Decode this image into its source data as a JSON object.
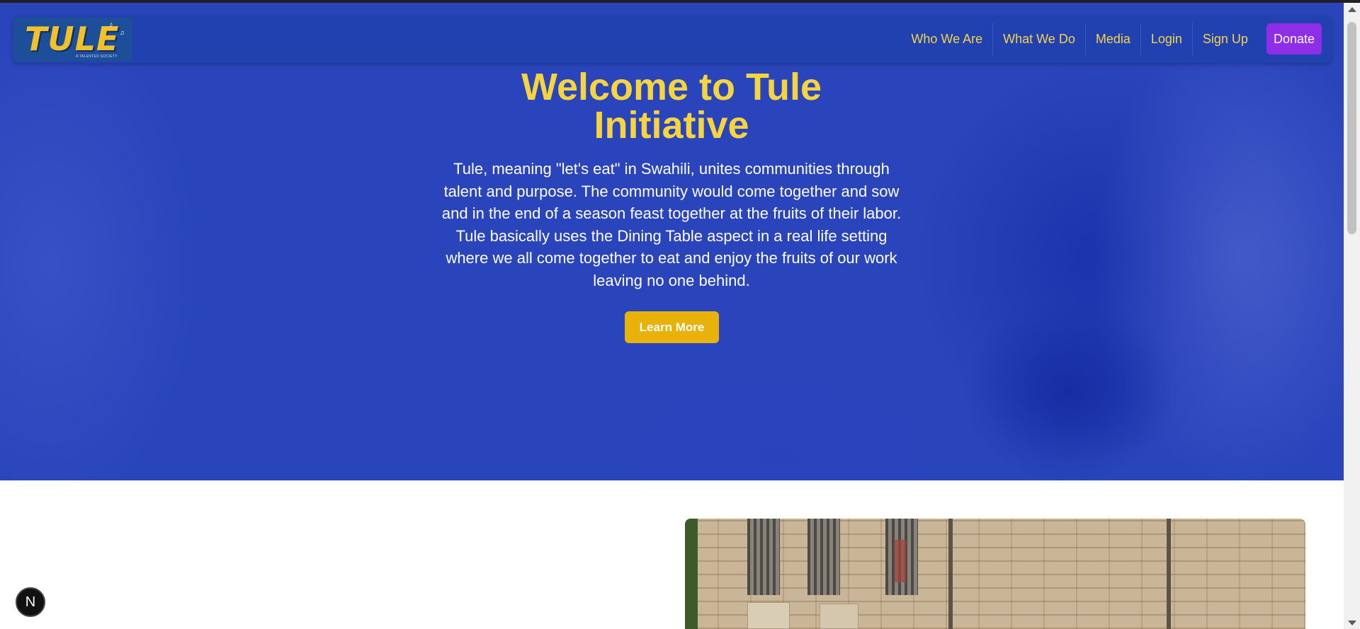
{
  "logo": {
    "text": "TULE",
    "subtext": "A TALENTED SOCIETY"
  },
  "nav": {
    "links": [
      {
        "label": "Who We Are"
      },
      {
        "label": "What We Do"
      },
      {
        "label": "Media"
      },
      {
        "label": "Login"
      },
      {
        "label": "Sign Up"
      }
    ],
    "donate_label": "Donate"
  },
  "hero": {
    "title": "Welcome to Tule Initiative",
    "text": "Tule, meaning \"let's eat\" in Swahili, unites communities through talent and purpose. The community would come together and sow and in the end of a season feast together at the fruits of their labor. Tule basically uses the Dining Table aspect in a real life setting where we all come together to eat and enjoy the fruits of our work leaving no one behind.",
    "cta_label": "Learn More"
  },
  "badge": {
    "letter": "N"
  },
  "colors": {
    "hero_bg": "#2a45bb",
    "navbar_bg": "#2141b0",
    "nav_text": "#f5d34a",
    "title": "#f6d43f",
    "donate_bg": "#8e2ee6",
    "cta_bg": "#e9b20a"
  },
  "icons": {
    "logo_notes": "music-note-icon",
    "badge": "nextjs-icon",
    "scroll_up": "arrow-up-icon",
    "scroll_down": "arrow-down-icon"
  }
}
